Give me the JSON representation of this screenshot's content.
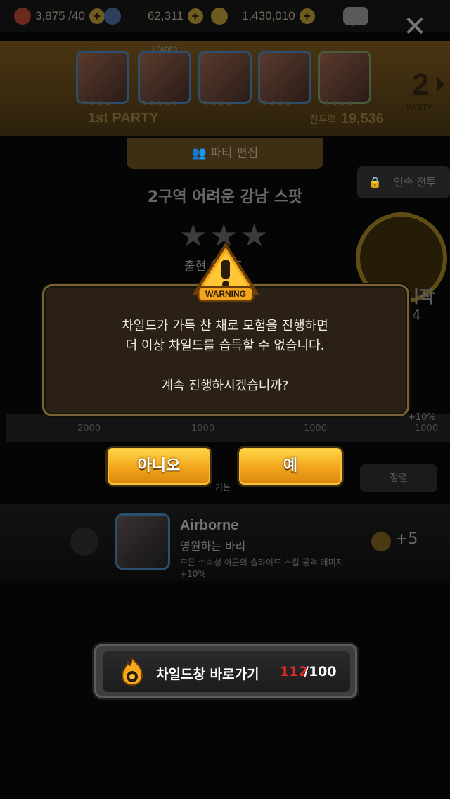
{
  "resources": {
    "stamina": "3,875 /40",
    "gems": "62,311",
    "gold": "1,430,010"
  },
  "party": {
    "label": "1st PARTY",
    "power_label": "전투력",
    "power_value": "19,536",
    "next_number": "2",
    "next_label": "PARTY",
    "portrait_badge": "LEADER"
  },
  "background": {
    "edit_button": "파티 편집",
    "auto_battle": "연속 전투",
    "stage_title": "2구역 어려운 강남 스팟",
    "child_label": "출현 차일드",
    "start_label": "시작",
    "start_cost": "4",
    "rewards": [
      "2000",
      "1000",
      "1000",
      "1000"
    ],
    "reward_bonus": "+10%",
    "sort_button": "정렬",
    "base_label": "기본"
  },
  "skill": {
    "name": "Airborne",
    "subtitle": "영원하는 바리",
    "description": "모든 수속성 아군의 슬라이드 스킬 공격 데미지",
    "percent": "+10%",
    "bonus": "+5"
  },
  "modal": {
    "warning_label": "WARNING",
    "line1": "차일드가 가득 찬 채로 모험을 진행하면",
    "line2": "더 이상 차일드를 습득할 수 없습니다.",
    "question": "계속 진행하시겠습니까?",
    "no_button": "아니오",
    "yes_button": "예"
  },
  "shortcut": {
    "label": "차일드창 바로가기",
    "current": "112",
    "separator_max": "/100"
  },
  "colors": {
    "accent_gold": "#f1a41a",
    "over_limit_red": "#e22b2b",
    "modal_border": "#7a6232"
  }
}
